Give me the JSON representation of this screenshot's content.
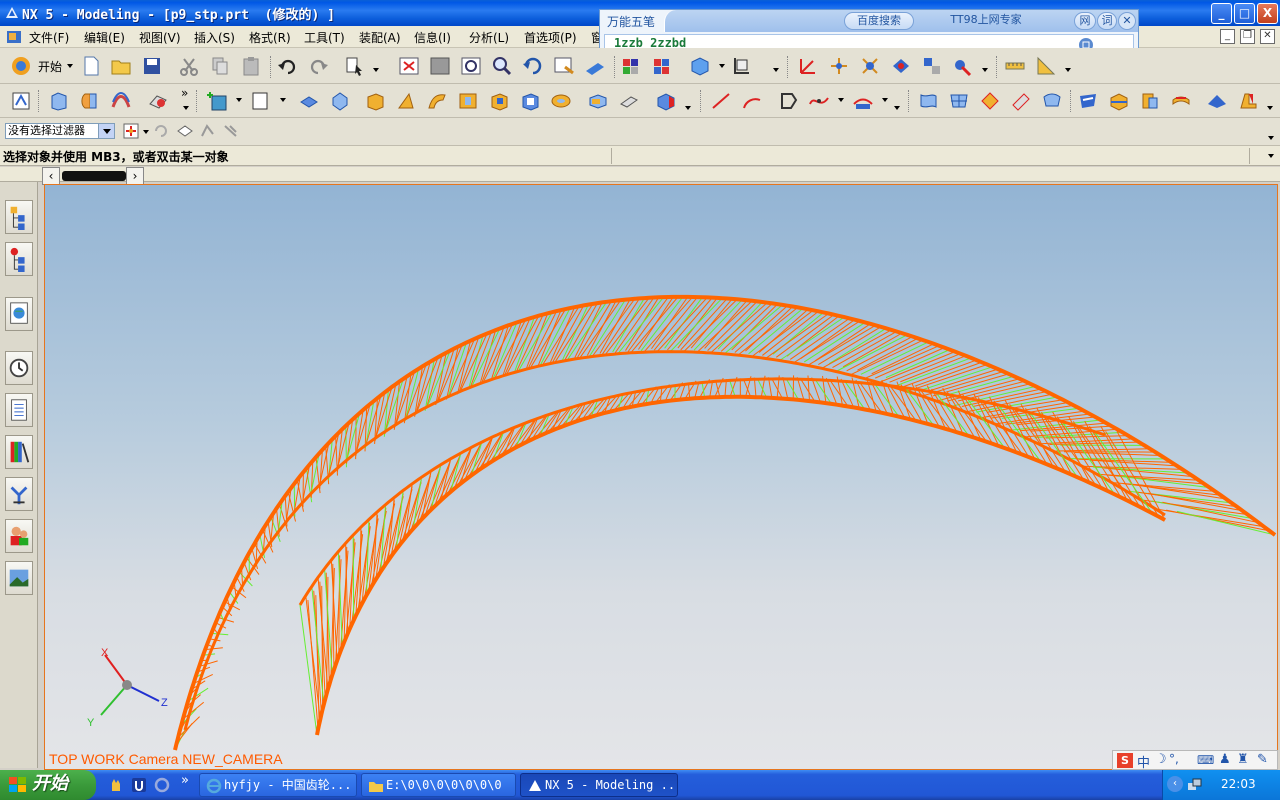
{
  "window": {
    "title": "NX 5 - Modeling - [p9_stp.prt  (修改的) ]",
    "buttons": [
      "_",
      "□",
      "X"
    ]
  },
  "ime_panel": {
    "name": "万能五笔",
    "buttons": [
      "百度搜索",
      "TT98上网专家",
      "网",
      "词"
    ],
    "input": "1zzb 2zzbd"
  },
  "menu": {
    "items": [
      "文件(F)",
      "编辑(E)",
      "视图(V)",
      "插入(S)",
      "格式(R)",
      "工具(T)",
      "装配(A)",
      "信息(I)",
      "分析(L)",
      "首选项(P)",
      "窗"
    ]
  },
  "toolbar": {
    "start_label": "开始",
    "filter_value": "没有选择过滤器"
  },
  "status": {
    "prompt": "选择对象并使用 MB3，或者双击某一对象"
  },
  "viewport": {
    "view_label": "TOP WORK Camera NEW_CAMERA",
    "triad": {
      "x": "X",
      "y": "Y",
      "z": "Z"
    },
    "colors": {
      "mesh_orange": "#ff6600",
      "mesh_green": "#66ee33",
      "border": "#e6751d"
    }
  },
  "taskbar": {
    "start": "开始",
    "tasks": [
      "hyfjy - 中国齿轮...",
      "E:\\0\\0\\0\\0\\0\\0\\0",
      "NX 5 - Modeling ..."
    ],
    "clock": "22:03",
    "ime_glyphs": [
      "中",
      "°,"
    ]
  }
}
